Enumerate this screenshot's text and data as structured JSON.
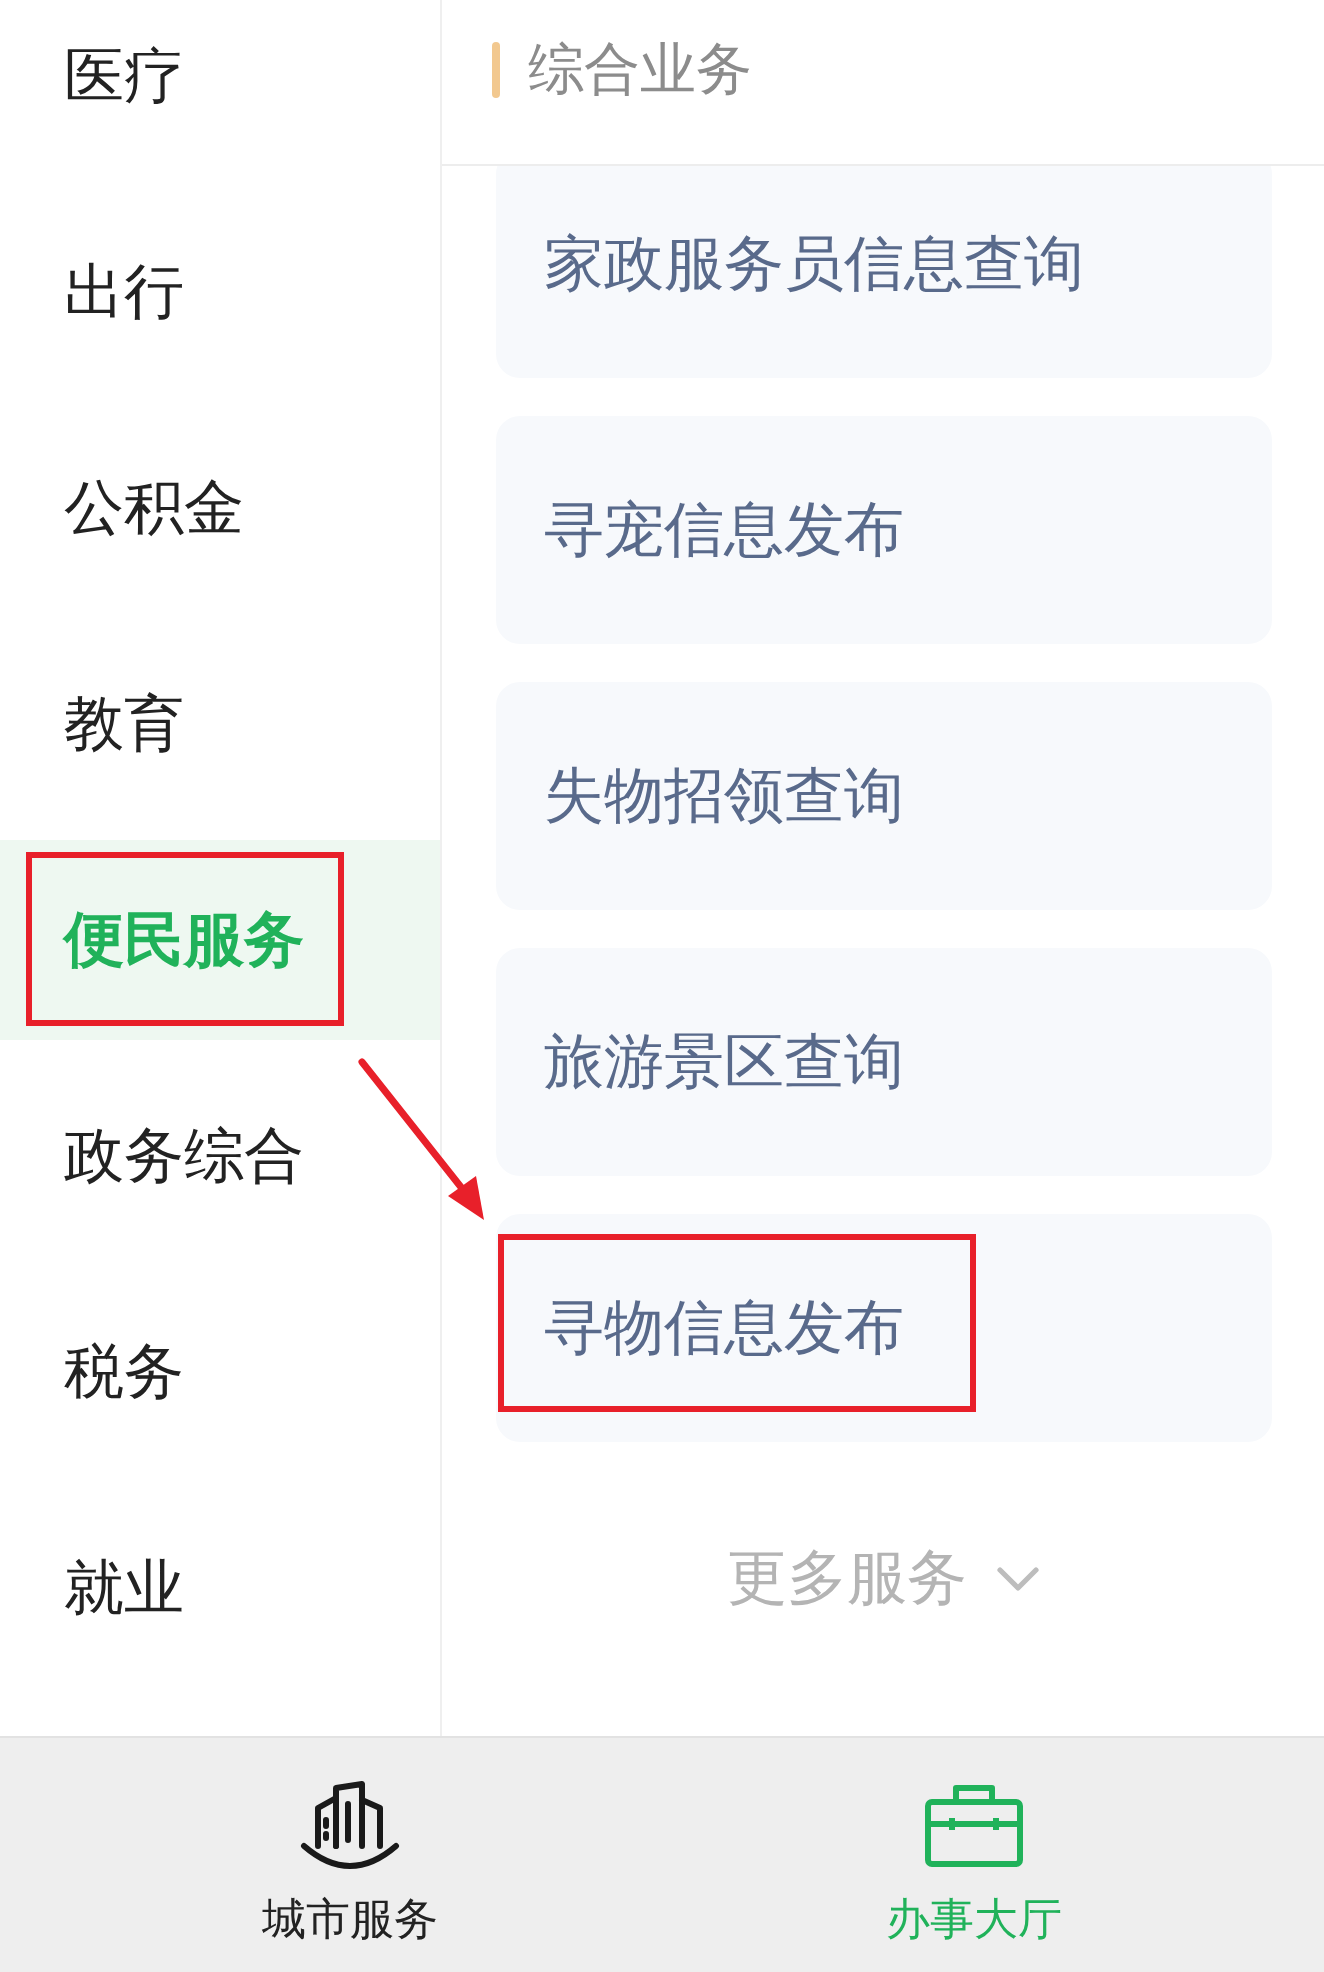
{
  "sidebar": {
    "items": [
      {
        "label": "医疗",
        "selected": false,
        "marked": false
      },
      {
        "label": "出行",
        "selected": false,
        "marked": false
      },
      {
        "label": "公积金",
        "selected": false,
        "marked": false
      },
      {
        "label": "教育",
        "selected": false,
        "marked": false
      },
      {
        "label": "便民服务",
        "selected": true,
        "marked": true
      },
      {
        "label": "政务综合",
        "selected": false,
        "marked": false
      },
      {
        "label": "税务",
        "selected": false,
        "marked": false
      },
      {
        "label": "就业",
        "selected": false,
        "marked": false
      }
    ]
  },
  "section": {
    "title": "综合业务"
  },
  "services": [
    {
      "label": "家政服务员信息查询",
      "marked": false
    },
    {
      "label": "寻宠信息发布",
      "marked": false
    },
    {
      "label": "失物招领查询",
      "marked": false
    },
    {
      "label": "旅游景区查询",
      "marked": false
    },
    {
      "label": "寻物信息发布",
      "marked": true
    }
  ],
  "more_button": {
    "label": "更多服务"
  },
  "annotation_arrow": true,
  "bottom_nav": {
    "tabs": [
      {
        "label": "城市服务",
        "selected": false
      },
      {
        "label": "办事大厅",
        "selected": true
      }
    ]
  }
}
